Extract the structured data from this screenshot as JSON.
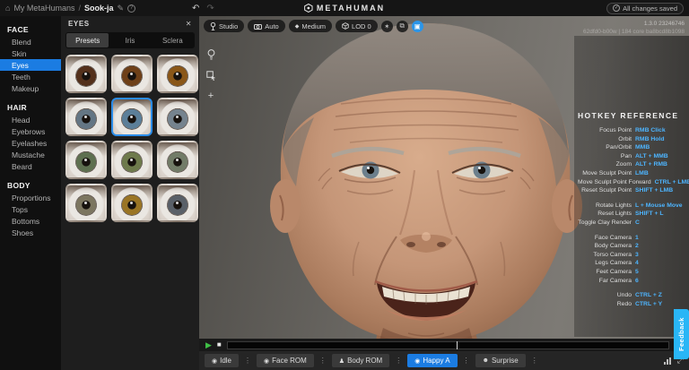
{
  "top_bar": {
    "breadcrumb": {
      "root": "My MetaHumans",
      "separator": "/",
      "current": "Sook-ja"
    },
    "saved_status": "All changes saved"
  },
  "logo": {
    "text": "METAHUMAN"
  },
  "icons": {
    "home": "⌂",
    "edit": "✎",
    "help": "?",
    "undo": "↶",
    "redo": "↷",
    "check": "✓",
    "close": "✕",
    "sparkle": "✶",
    "layers": "⧉",
    "capture": "▣",
    "diamond": "◆",
    "plus": "+",
    "play": "▶",
    "stop": "■",
    "menu_dots": "⋮",
    "expand": "⤢",
    "clip_target": "◉",
    "clip_person": "♟",
    "clip_smiley": "☻"
  },
  "sidebar": {
    "sections": [
      {
        "title": "FACE",
        "items": [
          {
            "label": "Blend",
            "selected": false
          },
          {
            "label": "Skin",
            "selected": false
          },
          {
            "label": "Eyes",
            "selected": true
          },
          {
            "label": "Teeth",
            "selected": false
          },
          {
            "label": "Makeup",
            "selected": false
          }
        ]
      },
      {
        "title": "HAIR",
        "items": [
          {
            "label": "Head",
            "selected": false
          },
          {
            "label": "Eyebrows",
            "selected": false
          },
          {
            "label": "Eyelashes",
            "selected": false
          },
          {
            "label": "Mustache",
            "selected": false
          },
          {
            "label": "Beard",
            "selected": false
          }
        ]
      },
      {
        "title": "BODY",
        "items": [
          {
            "label": "Proportions",
            "selected": false
          },
          {
            "label": "Tops",
            "selected": false
          },
          {
            "label": "Bottoms",
            "selected": false
          },
          {
            "label": "Shoes",
            "selected": false
          }
        ]
      }
    ]
  },
  "eyes_panel": {
    "title": "EYES",
    "tabs": [
      {
        "label": "Presets",
        "active": true
      },
      {
        "label": "Iris",
        "active": false
      },
      {
        "label": "Sclera",
        "active": false
      }
    ],
    "presets": [
      {
        "name": "dark-brown",
        "iris": "#53301b",
        "selected": false
      },
      {
        "name": "brown",
        "iris": "#6e4018",
        "selected": false
      },
      {
        "name": "amber-brown",
        "iris": "#8a5718",
        "selected": false
      },
      {
        "name": "blue-gray",
        "iris": "#647684",
        "selected": false
      },
      {
        "name": "blue",
        "iris": "#5c7f99",
        "selected": true
      },
      {
        "name": "gray-blue",
        "iris": "#75838e",
        "selected": false
      },
      {
        "name": "green",
        "iris": "#5e7050",
        "selected": false
      },
      {
        "name": "hazel-green",
        "iris": "#6e7a4c",
        "selected": false
      },
      {
        "name": "gray-green",
        "iris": "#727c68",
        "selected": false
      },
      {
        "name": "hazel-gray",
        "iris": "#7c7660",
        "selected": false
      },
      {
        "name": "amber-yellow",
        "iris": "#9a7524",
        "selected": false
      },
      {
        "name": "dark-gray",
        "iris": "#596068",
        "selected": false
      }
    ]
  },
  "viewport": {
    "toolbar": {
      "studio": "Studio",
      "camera_mode": "Auto",
      "quality": "Medium",
      "lod": "LOD 0"
    },
    "version_line1": "1.3.0 23246746",
    "version_line2": "62dfd0-b00w | 184 core ba8bcd8b1098",
    "feedback_label": "Feedback"
  },
  "hotkeys": {
    "title": "HOTKEY REFERENCE",
    "groups": [
      [
        {
          "label": "Focus Point",
          "key": "RMB Click"
        },
        {
          "label": "Orbit",
          "key": "RMB Hold"
        },
        {
          "label": "Pan/Orbit",
          "key": "MMB"
        },
        {
          "label": "Pan",
          "key": "ALT + MMB"
        },
        {
          "label": "Zoom",
          "key": "ALT + RMB"
        },
        {
          "label": "Move Sculpt Point",
          "key": "LMB"
        },
        {
          "label": "Move Sculpt Point Forward",
          "key": "CTRL + LMB"
        },
        {
          "label": "Reset Sculpt Point",
          "key": "SHIFT + LMB"
        }
      ],
      [
        {
          "label": "Rotate Lights",
          "key": "L + Mouse Move"
        },
        {
          "label": "Reset Lights",
          "key": "SHIFT + L"
        },
        {
          "label": "Toggle Clay Render",
          "key": "C"
        }
      ],
      [
        {
          "label": "Face Camera",
          "key": "1"
        },
        {
          "label": "Body Camera",
          "key": "2"
        },
        {
          "label": "Torso Camera",
          "key": "3"
        },
        {
          "label": "Legs Camera",
          "key": "4"
        },
        {
          "label": "Feet Camera",
          "key": "5"
        },
        {
          "label": "Far Camera",
          "key": "6"
        }
      ],
      [
        {
          "label": "Undo",
          "key": "CTRL + Z"
        },
        {
          "label": "Redo",
          "key": "CTRL + Y"
        }
      ]
    ]
  },
  "timeline": {
    "clips": [
      {
        "label": "Idle",
        "icon": "clip_target",
        "selected": false
      },
      {
        "label": "Face ROM",
        "icon": "clip_target",
        "selected": false
      },
      {
        "label": "Body ROM",
        "icon": "clip_person",
        "selected": false
      },
      {
        "label": "Happy A",
        "icon": "clip_target",
        "selected": true
      },
      {
        "label": "Surprise",
        "icon": "clip_smiley",
        "selected": false
      }
    ]
  },
  "colors": {
    "accent": "#1b7ce2",
    "selected_border": "#2b8ce8",
    "hotkey_key": "#4db5ff",
    "feedback": "#29b6f6",
    "play": "#3fbf46",
    "toggle_active": "#2b95e8"
  }
}
